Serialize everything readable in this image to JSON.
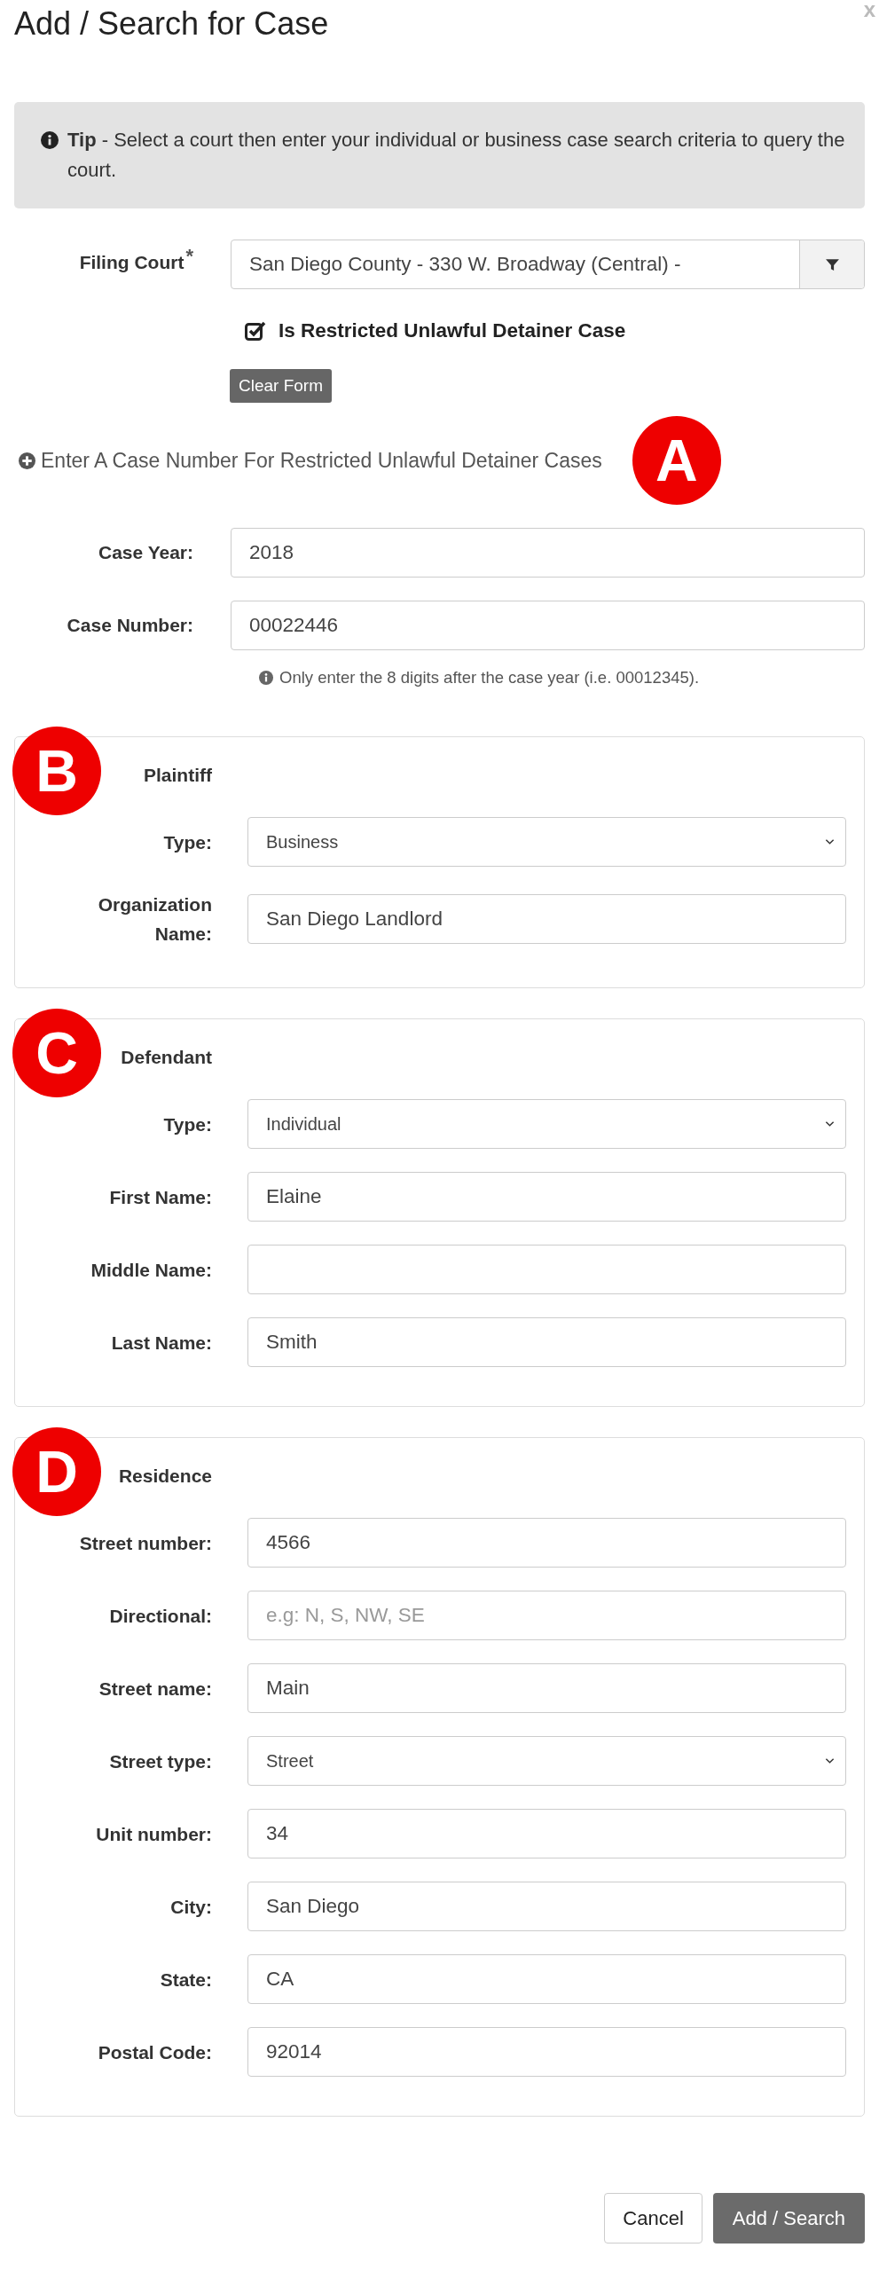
{
  "dialog": {
    "title": "Add / Search for Case",
    "close": "x"
  },
  "tip": "**Tip** - Select a court then enter your individual or business case search criteria to query the court.",
  "filing_court": {
    "label": "Filing Court",
    "required_mark": "*",
    "value": "San Diego County - 330 W. Broadway (Central) -"
  },
  "restricted_checkbox": {
    "label": "Is Restricted Unlawful Detainer Case",
    "checked": true
  },
  "clear_button": "Clear Form",
  "case_number_link": {
    "text": "Enter A Case Number For Restricted Unlawful Detainer Cases",
    "marker": "A"
  },
  "case_fields": [
    {
      "label": "Case Year:",
      "value": "2018"
    },
    {
      "label": "Case Number:",
      "value": "00022446"
    }
  ],
  "case_hint": "Only enter the 8 digits after the case year (i.e. 00012345).",
  "sections": [
    {
      "title": "Plaintiff",
      "marker": "B",
      "fields": [
        {
          "kind": "select",
          "label": "Type:",
          "value": "Business"
        },
        {
          "kind": "text",
          "label": "Organization Name:",
          "value": "San Diego Landlord"
        }
      ]
    },
    {
      "title": "Defendant",
      "marker": "C",
      "fields": [
        {
          "kind": "select",
          "label": "Type:",
          "value": "Individual"
        },
        {
          "kind": "text",
          "label": "First Name:",
          "value": "Elaine"
        },
        {
          "kind": "text",
          "label": "Middle Name:"
        },
        {
          "kind": "text",
          "label": "Last Name:",
          "value": "Smith"
        }
      ]
    },
    {
      "title": "Residence",
      "marker": "D",
      "fields": [
        {
          "kind": "text",
          "label": "Street number:",
          "value": "4566"
        },
        {
          "kind": "text",
          "label": "Directional:",
          "placeholder": "e.g: N, S, NW, SE"
        },
        {
          "kind": "text",
          "label": "Street name:",
          "value": "Main"
        },
        {
          "kind": "select",
          "label": "Street type:",
          "value": "Street"
        },
        {
          "kind": "text",
          "label": "Unit number:",
          "value": "34"
        },
        {
          "kind": "text",
          "label": "City:",
          "value": "San Diego"
        },
        {
          "kind": "text",
          "label": "State:",
          "value": "CA"
        },
        {
          "kind": "text",
          "label": "Postal Code:",
          "value": "92014"
        }
      ]
    }
  ],
  "buttons": [
    {
      "label": "Cancel",
      "kind": "secondary"
    },
    {
      "label": "Add / Search",
      "kind": "primary"
    }
  ]
}
